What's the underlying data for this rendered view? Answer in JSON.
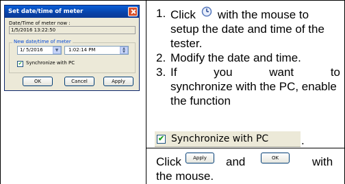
{
  "dialog": {
    "title": "Set date/time of meter",
    "now_label": "Date/Time of meter now :",
    "now_value": "1/5/2016 13:22:50",
    "group_label": "New date/time of meter",
    "date_value": "1/ 5/2016",
    "time_value": "1:02:14 PM",
    "sync_checked": true,
    "sync_label": "Synchronize with PC",
    "ok_label": "OK",
    "cancel_label": "Cancel",
    "apply_label": "Apply"
  },
  "steps": [
    {
      "num": "1.",
      "line1_before": "Click",
      "line1_after": "with the mouse",
      "icon": "clock-icon",
      "rest": "to setup the date and time of the tester."
    },
    {
      "num": "2.",
      "text": "Modify the date and time."
    },
    {
      "num": "3.",
      "words": [
        "If",
        "you",
        "want",
        "to"
      ],
      "rest": "synchronize with the PC, enable the function"
    }
  ],
  "sync_strip_label": "Synchronize with PC",
  "sync_strip_suffix": ".",
  "final": {
    "click_word": "Click",
    "and_word": "and",
    "with_word": "with",
    "tail": "the mouse.",
    "apply_label": "Apply",
    "ok_label": "OK"
  },
  "colors": {
    "dialog_bg": "#ece9d8",
    "title_bar": "#0a5fd8",
    "close_button": "#d9502b",
    "check_green": "#21a121"
  }
}
